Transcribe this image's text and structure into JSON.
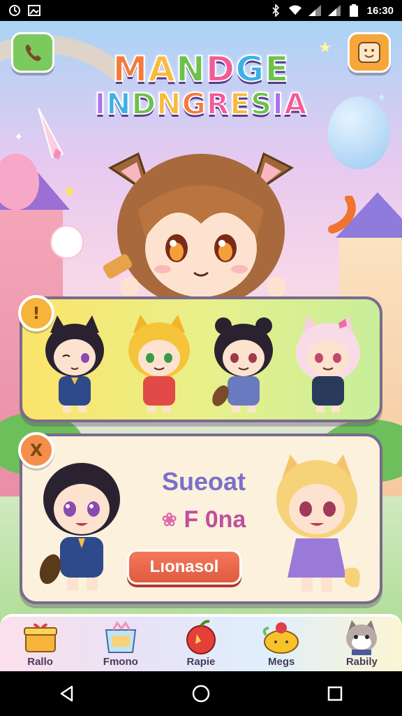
{
  "status_bar": {
    "time": "16:30"
  },
  "title": {
    "line1": [
      "M",
      "A",
      "N",
      "D",
      "G",
      "E"
    ],
    "line2": [
      "I",
      "N",
      "D",
      "N",
      "G",
      "R",
      "E",
      "S",
      "I",
      "A"
    ]
  },
  "panel_chars": {
    "badge": "!"
  },
  "panel_select": {
    "badge": "X",
    "title": "Sueoat",
    "subtitle": "F 0na",
    "button_label": "Lıonasol"
  },
  "tabs": [
    {
      "label": "Rallo",
      "icon": "gift-box-icon"
    },
    {
      "label": "Fmono",
      "icon": "shopping-bag-icon"
    },
    {
      "label": "Rapie",
      "icon": "apple-icon"
    },
    {
      "label": "Megs",
      "icon": "food-bowl-icon"
    },
    {
      "label": "Rabily",
      "icon": "cat-face-icon"
    }
  ],
  "colors": {
    "accent_green": "#7cc95e",
    "accent_orange": "#f7a63a",
    "button_red": "#e05a40",
    "panel_border": "#7a6a8c"
  }
}
